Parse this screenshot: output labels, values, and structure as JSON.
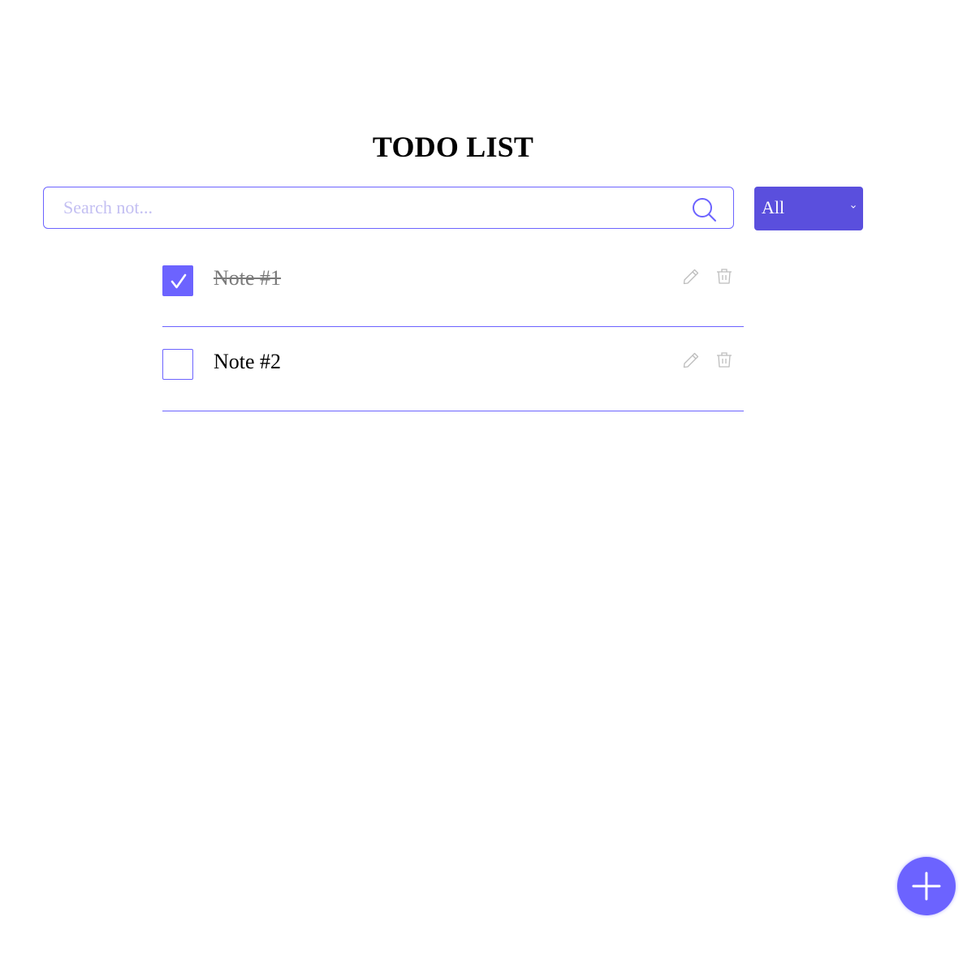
{
  "header": {
    "title": "TODO LIST"
  },
  "search": {
    "placeholder": "Search not...",
    "value": ""
  },
  "filter": {
    "selected": "All"
  },
  "todos": [
    {
      "label": "Note #1",
      "done": true
    },
    {
      "label": "Note #2",
      "done": false
    }
  ],
  "colors": {
    "accent": "#6c63ff",
    "filter_bg": "#5a4fdd",
    "placeholder": "#c3bff2",
    "icon_muted": "#bdbdbd",
    "done_text": "#7a7a7a"
  },
  "icons": {
    "search": "search-icon",
    "filter_chevron": "chevron-down-icon",
    "checkbox_check": "check-icon",
    "edit": "pencil-icon",
    "delete": "trash-icon",
    "add": "plus-icon"
  }
}
